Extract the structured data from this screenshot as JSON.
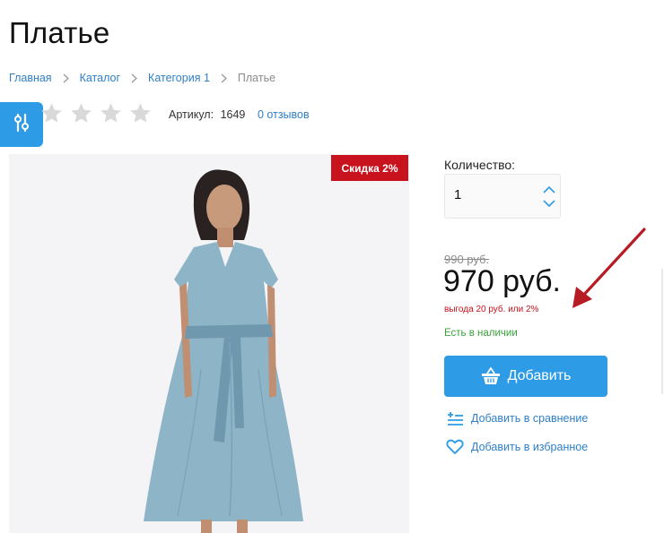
{
  "product": {
    "title": "Платье",
    "sku_label": "Артикул:",
    "sku_value": "1649",
    "reviews": "0 отзывов",
    "rating": 0,
    "rating_max": 5
  },
  "breadcrumb": {
    "items": [
      "Главная",
      "Каталог",
      "Категория 1"
    ],
    "current": "Платье"
  },
  "badge": {
    "discount": "Скидка 2%"
  },
  "quantity": {
    "label": "Количество:",
    "value": "1"
  },
  "price": {
    "old": "990 руб.",
    "new": "970 руб.",
    "savings": "выгода 20 руб. или 2%"
  },
  "stock": {
    "status": "Есть в наличии"
  },
  "actions": {
    "add_to_cart": "Добавить",
    "compare": "Добавить в сравнение",
    "favorite": "Добавить в избранное"
  },
  "colors": {
    "accent": "#2d9be5",
    "link": "#2f7fc8",
    "sale_red": "#c8121d",
    "stock_green": "#3aa13a",
    "star_empty": "#d9d9d9"
  },
  "icons": {
    "filter": "sliders-icon",
    "cart": "basket-icon",
    "compare": "compare-list-icon",
    "favorite": "heart-icon",
    "arrow": "annotation-arrow-icon"
  }
}
